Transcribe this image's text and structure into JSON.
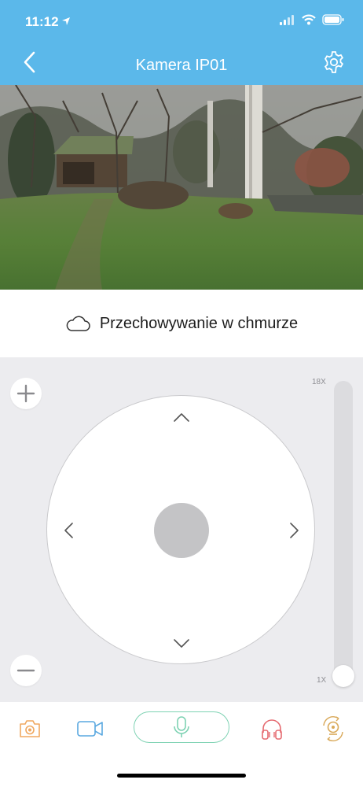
{
  "status_bar": {
    "time": "11:12",
    "icons": [
      "location-arrow-icon",
      "signal-icon",
      "wifi-icon",
      "battery-icon"
    ]
  },
  "nav": {
    "title": "Kamera IP01",
    "back_icon": "back-chevron-icon",
    "settings_icon": "gear-icon"
  },
  "camera_view": {
    "description_icon": "live-camera-feed"
  },
  "cloud": {
    "label": "Przechowywanie w chmurze",
    "icon": "cloud-icon"
  },
  "ptz": {
    "zoom_max_label": "18X",
    "zoom_min_label": "1X",
    "zoom_level": 0.0,
    "arrows": [
      "arrow-up-icon",
      "arrow-down-icon",
      "arrow-left-icon",
      "arrow-right-icon"
    ]
  },
  "toolbar": {
    "items": [
      "snapshot-camera-icon",
      "video-record-icon",
      "microphone-icon",
      "headphones-icon",
      "cruise-rotate-icon"
    ]
  },
  "colors": {
    "header": "#5bb8ea",
    "panel": "#ececef",
    "snapshot": "#f0a860",
    "video": "#5aa8e0",
    "mic": "#7ed2b3",
    "headphones": "#e56a70",
    "cruise": "#d9a95a"
  }
}
